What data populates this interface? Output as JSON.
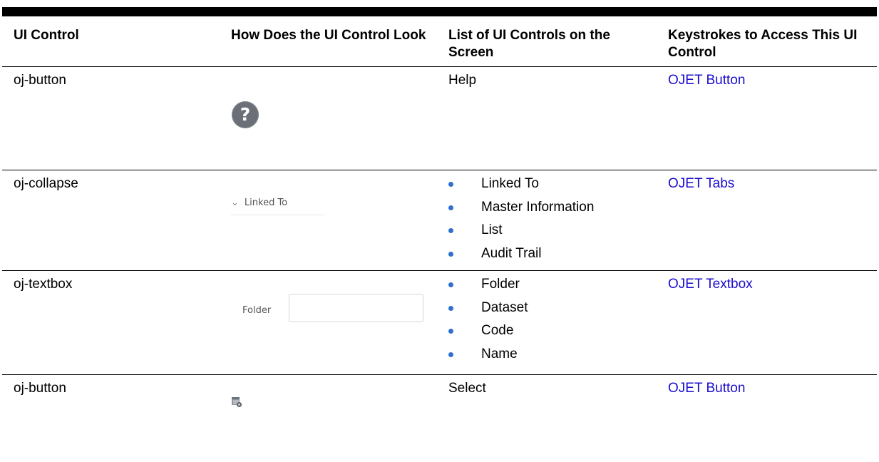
{
  "table": {
    "headers": [
      "UI Control",
      "How Does the UI Control Look",
      "List of UI Controls on the Screen",
      "Keystrokes to Access This UI Control"
    ],
    "rows": [
      {
        "control": "oj-button",
        "look_icon": "help-question-icon",
        "screen_text": "Help",
        "link": "OJET Button"
      },
      {
        "control": "oj-collapse",
        "look_label": "Linked To",
        "screen_items": [
          "Linked To",
          "Master Information",
          "List",
          "Audit Trail"
        ],
        "link": "OJET Tabs"
      },
      {
        "control": "oj-textbox",
        "look_label": "Folder",
        "screen_items": [
          "Folder",
          "Dataset",
          "Code",
          "Name"
        ],
        "link": "OJET Textbox"
      },
      {
        "control": "oj-button",
        "look_icon": "select-dialog-icon",
        "screen_text": "Select",
        "link": "OJET Button"
      }
    ]
  },
  "colors": {
    "link": "#1a0dcc",
    "bullet": "#2f6fcf",
    "header_bar": "#000000"
  }
}
